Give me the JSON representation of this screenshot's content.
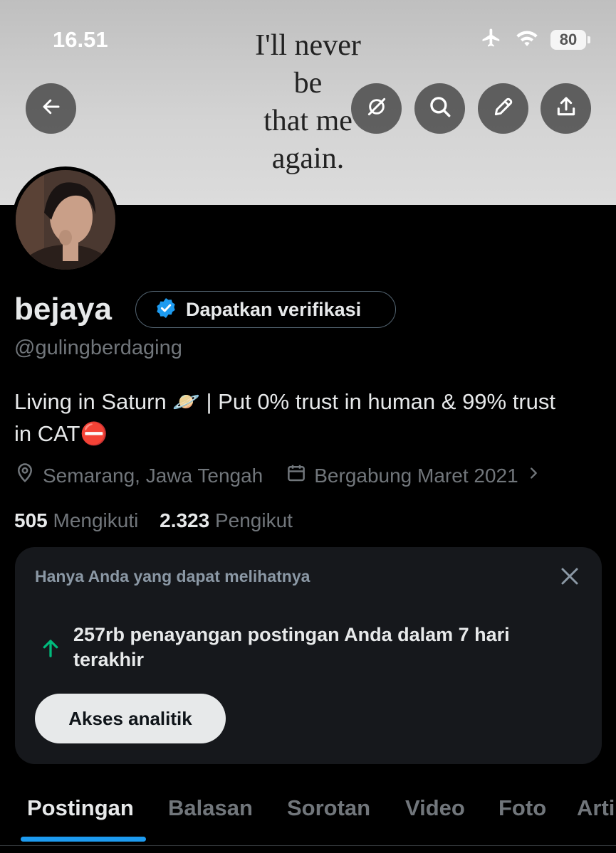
{
  "status_bar": {
    "time": "16.51",
    "battery": "80"
  },
  "banner": {
    "quote_lines": [
      "I'll never",
      "be",
      "that me",
      "again."
    ]
  },
  "profile": {
    "name": "bejaya",
    "verify_button": "Dapatkan verifikasi",
    "handle": "@gulingberdaging",
    "bio_line1": "Living in Saturn 🪐 | Put 0% trust in human & 99% trust",
    "bio_line2": "in CAT⛔",
    "location": "Semarang, Jawa Tengah",
    "joined": "Bergabung Maret 2021",
    "following_count": "505",
    "following_label": "Mengikuti",
    "followers_count": "2.323",
    "followers_label": "Pengikut"
  },
  "analytics_card": {
    "title": "Hanya Anda yang dapat melihatnya",
    "text": "257rb penayangan postingan Anda dalam 7 hari terakhir",
    "button": "Akses analitik"
  },
  "tabs": [
    "Postingan",
    "Balasan",
    "Sorotan",
    "Video",
    "Foto",
    "Artikel"
  ],
  "colors": {
    "accent": "#1d9bf0",
    "verify_badge": "#1d9bf0",
    "trend_up": "#00ba7c",
    "muted": "#71767b"
  }
}
